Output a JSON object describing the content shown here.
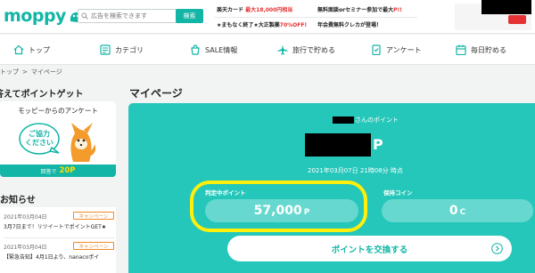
{
  "header": {
    "logo_text": "moppy",
    "search_placeholder": "広告を検索できます",
    "search_button": "検索",
    "promos": [
      {
        "prefix": "楽天カード ",
        "highlight": "最大18,000円相当"
      },
      {
        "prefix": "無料面談orセミナー参加で最大",
        "highlight": "P!!"
      },
      {
        "prefix": "★まもなく終了★大正製薬",
        "highlight": "70%OFF!"
      },
      {
        "prefix": "年会費無料クレカが登場！",
        "highlight": ""
      }
    ]
  },
  "nav": {
    "items": [
      {
        "label": "トップ",
        "icon": "home-icon"
      },
      {
        "label": "カテゴリ",
        "icon": "category-icon"
      },
      {
        "label": "SALE情報",
        "icon": "sale-icon"
      },
      {
        "label": "旅行で貯める",
        "icon": "airplane-icon"
      },
      {
        "label": "アンケート",
        "icon": "survey-icon"
      },
      {
        "label": "毎日貯める",
        "icon": "calendar-icon"
      }
    ]
  },
  "breadcrumb": {
    "items": [
      "トップ",
      ">",
      "マイページ"
    ]
  },
  "left": {
    "survey_title": "答えてポイントゲット",
    "survey_card_title": "モッピーからのアンケート",
    "survey_bubble": "ご協力\nください",
    "survey_reward_label": "回答で",
    "survey_reward_value": "20P",
    "notice_title": "お知らせ",
    "notices": [
      {
        "date": "2021年03月04日",
        "badge": "キャンペーン",
        "text": "3月7日まで！リツイートでポイントGET★"
      },
      {
        "date": "2021年03月04日",
        "badge": "キャンペーン",
        "text": "【緊急告知】4月1日より、nanacoポイ"
      }
    ]
  },
  "main": {
    "title": "マイページ",
    "owner_suffix": "さんのポイント",
    "balance_unit": "P",
    "timestamp": "2021年03月07日 21時08分 時点",
    "pending_label": "判定中ポイント",
    "pending_value": "57,000",
    "pending_unit": "P",
    "coin_label": "保持コイン",
    "coin_value": "0",
    "coin_unit": "C",
    "exchange_button": "ポイントを交換する"
  },
  "colors": {
    "brand": "#13b5a6",
    "panel": "#25c7ba",
    "highlight": "#ffef0a",
    "accent_red": "#e53333",
    "badge_orange": "#f08a24"
  }
}
